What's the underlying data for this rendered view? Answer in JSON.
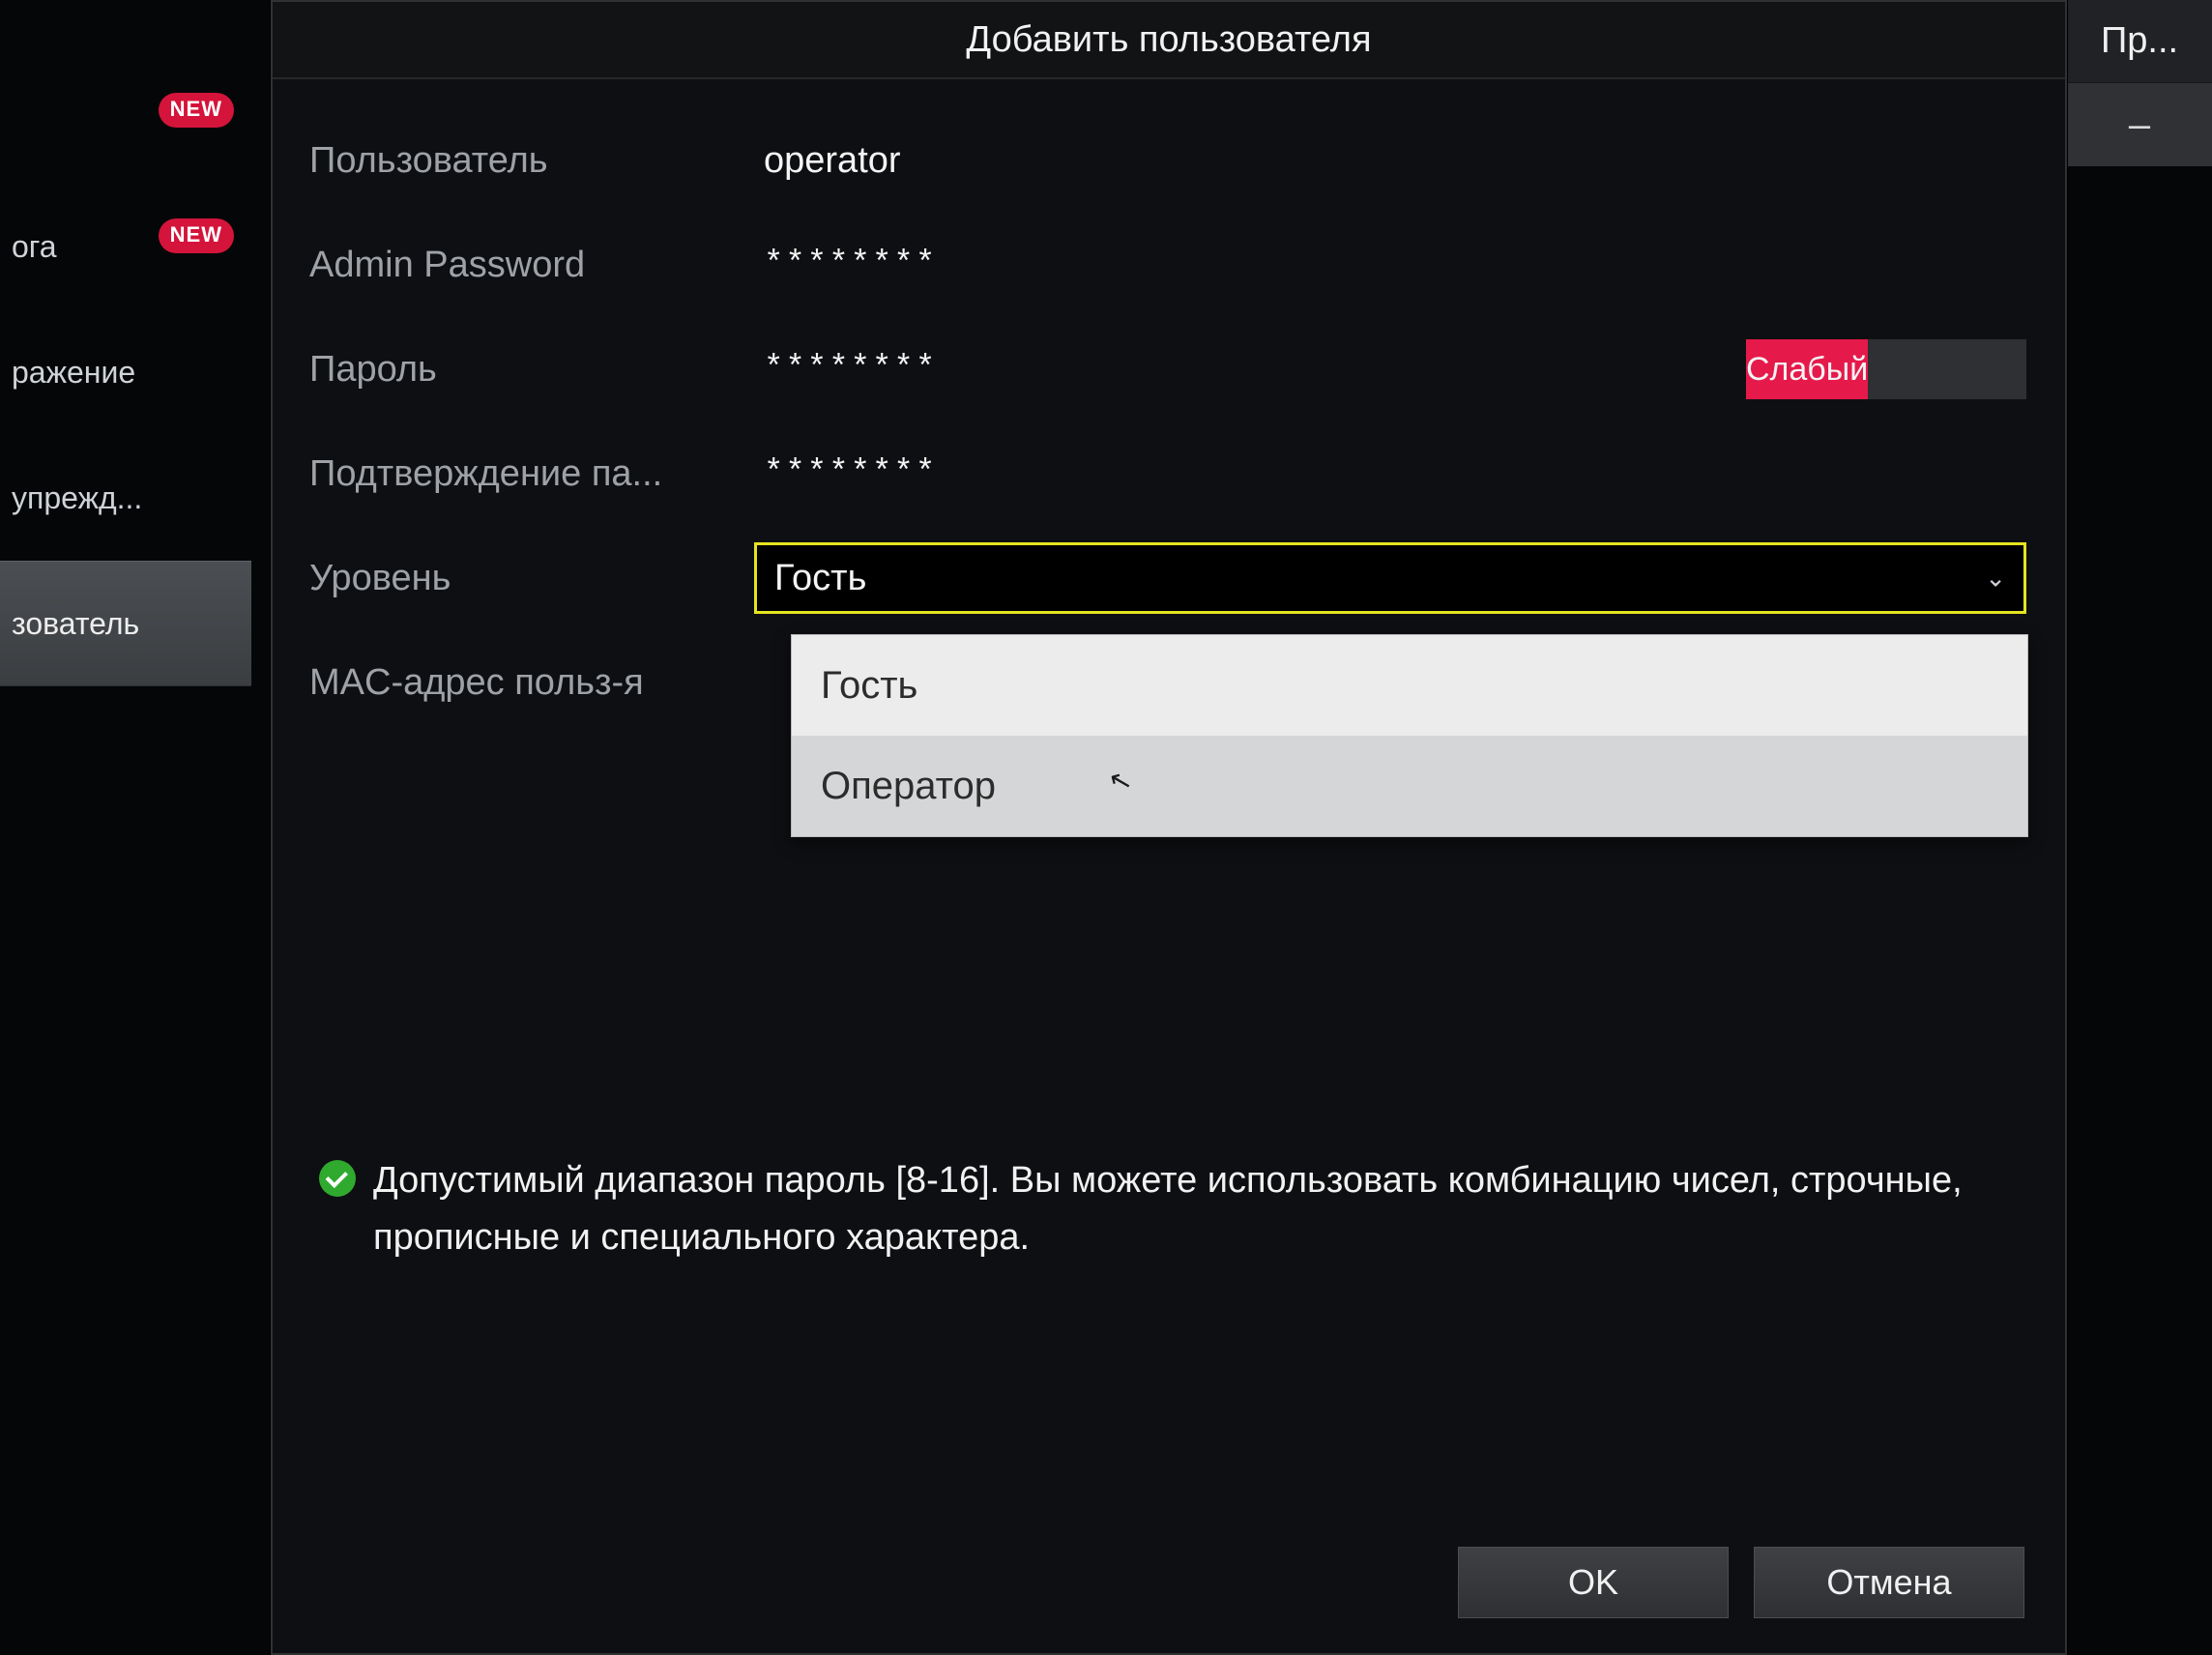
{
  "nav": {
    "items": [
      {
        "label": "",
        "badge": "NEW"
      },
      {
        "label": "ога",
        "badge": "NEW"
      },
      {
        "label": "ражение",
        "badge": null
      },
      {
        "label": "упрежд...",
        "badge": null
      },
      {
        "label": "зователь",
        "badge": null
      }
    ]
  },
  "corner": {
    "title": "Пр...",
    "row": "–"
  },
  "dialog": {
    "title": "Добавить пользователя",
    "fields": {
      "user_label": "Пользователь",
      "user_value": "operator",
      "admin_pwd_label": "Admin Password",
      "admin_pwd_mask": "********",
      "pwd_label": "Пароль",
      "pwd_mask": "********",
      "pwd_strength": "Слабый",
      "confirm_label": "Подтверждение па...",
      "confirm_mask": "********",
      "level_label": "Уровень",
      "level_value": "Гость",
      "level_options": [
        "Гость",
        "Оператор"
      ],
      "mac_label": "MAC-адрес польз-я"
    },
    "hint": "Допустимый диапазон пароль [8-16]. Вы можете использовать комбинацию чисел, строчные, прописные и специального характера.",
    "buttons": {
      "ok": "OK",
      "cancel": "Отмена"
    }
  }
}
